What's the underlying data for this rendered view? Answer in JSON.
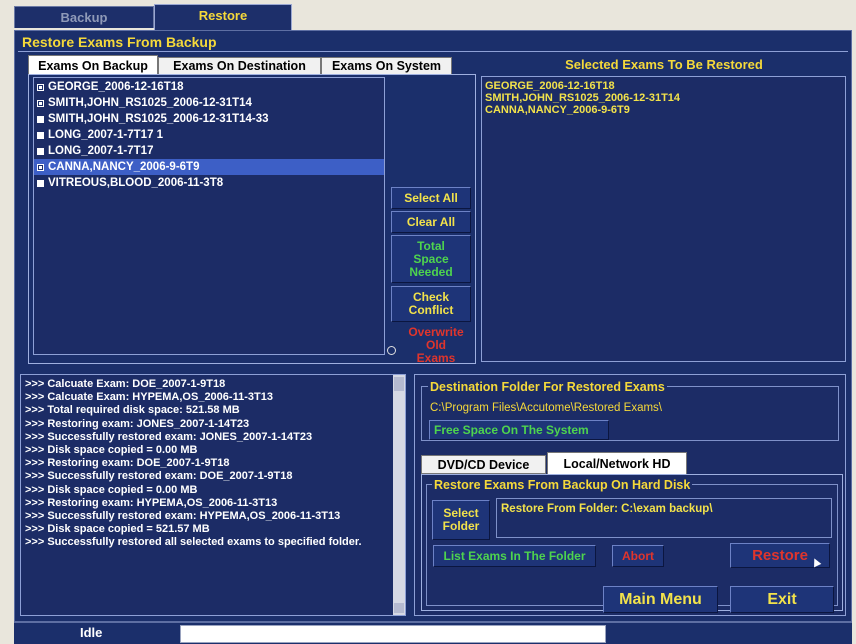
{
  "top_tabs": [
    {
      "label": "Backup"
    },
    {
      "label": "Restore"
    }
  ],
  "section_title": "Restore Exams From Backup",
  "source_tabs": [
    "Exams On Backup",
    "Exams On Destination",
    "Exams On System"
  ],
  "exams": [
    {
      "name": "GEORGE_2006-12-16T18",
      "checked": true,
      "selected": false
    },
    {
      "name": "SMITH,JOHN_RS1025_2006-12-31T14",
      "checked": true,
      "selected": false
    },
    {
      "name": "SMITH,JOHN_RS1025_2006-12-31T14-33",
      "checked": false,
      "selected": false
    },
    {
      "name": "LONG_2007-1-7T17 1",
      "checked": false,
      "selected": false
    },
    {
      "name": "LONG_2007-1-7T17",
      "checked": false,
      "selected": false
    },
    {
      "name": "CANNA,NANCY_2006-9-6T9",
      "checked": true,
      "selected": true
    },
    {
      "name": "VITREOUS,BLOOD_2006-11-3T8",
      "checked": false,
      "selected": false
    }
  ],
  "buttons": {
    "select_all": "Select All",
    "clear_all": "Clear All",
    "total_space": "Total Space Needed",
    "check_conflict": "Check Conflict",
    "overwrite": "Overwrite Old Exams",
    "free_space": "Free Space On The System",
    "select_folder": "Select Folder",
    "list_exams": "List Exams In The Folder",
    "abort": "Abort",
    "restore": "Restore",
    "main_menu": "Main Menu",
    "exit": "Exit"
  },
  "selected_panel": {
    "title": "Selected Exams To Be Restored",
    "items": [
      "GEORGE_2006-12-16T18",
      "SMITH,JOHN_RS1025_2006-12-31T14",
      "CANNA,NANCY_2006-9-6T9"
    ]
  },
  "log_lines": [
    ">>> Calcuate Exam: DOE_2007-1-9T18",
    ">>> Calcuate Exam: HYPEMA,OS_2006-11-3T13",
    ">>> Total required disk space: 521.58 MB",
    ">>> Restoring exam: JONES_2007-1-14T23",
    ">>> Successfully restored exam: JONES_2007-1-14T23",
    ">>> Disk space copied = 0.00 MB",
    ">>> Restoring exam: DOE_2007-1-9T18",
    ">>> Successfully restored exam: DOE_2007-1-9T18",
    ">>> Disk space copied = 0.00 MB",
    ">>> Restoring exam: HYPEMA,OS_2006-11-3T13",
    ">>> Successfully restored exam: HYPEMA,OS_2006-11-3T13",
    ">>> Disk space copied = 521.57 MB",
    ">>> Successfully restored all selected exams to specified folder."
  ],
  "destination": {
    "title": "Destination Folder For Restored Exams",
    "path": "C:\\Program Files\\Accutome\\Restored Exams\\"
  },
  "device_tabs": [
    "DVD/CD Device",
    "Local/Network HD"
  ],
  "hd_group": {
    "title": "Restore Exams From Backup On Hard Disk",
    "folder_text": "Restore From Folder: C:\\exam backup\\"
  },
  "status": {
    "text": "Idle"
  },
  "colors": {
    "navy": "#1b2f6b",
    "title_yellow": "#f5d93a",
    "green": "#4ed44e",
    "red": "#e0352c"
  }
}
